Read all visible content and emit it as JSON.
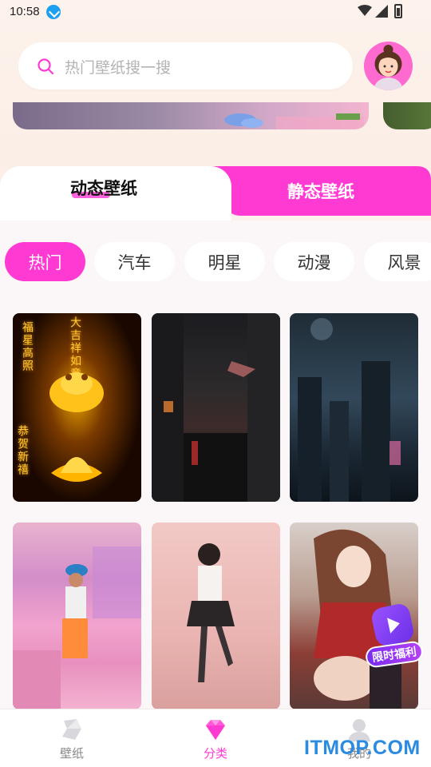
{
  "status_bar": {
    "time": "10:58"
  },
  "search": {
    "placeholder": "热门壁纸搜一搜"
  },
  "tabs": [
    {
      "label": "动态壁纸",
      "active": true
    },
    {
      "label": "静态壁纸",
      "active": false
    }
  ],
  "categories": [
    {
      "label": "热门",
      "active": true
    },
    {
      "label": "汽车",
      "active": false
    },
    {
      "label": "明星",
      "active": false
    },
    {
      "label": "动漫",
      "active": false
    },
    {
      "label": "风景",
      "active": false
    }
  ],
  "wallpaper1_text": {
    "col1": "福星高照",
    "col2": "大吉祥如意",
    "col3": "恭贺新禧"
  },
  "promo": {
    "label": "限时福利",
    "badge": "Video"
  },
  "bottom_nav": [
    {
      "label": "壁纸",
      "icon": "wallpaper-icon",
      "active": false
    },
    {
      "label": "分类",
      "icon": "diamond-icon",
      "active": true
    },
    {
      "label": "我的",
      "icon": "profile-icon",
      "active": false
    }
  ],
  "watermark": "ITMOP.COM",
  "colors": {
    "accent": "#ff3ad3",
    "tab_inactive_bg": "#ff3ad3"
  }
}
